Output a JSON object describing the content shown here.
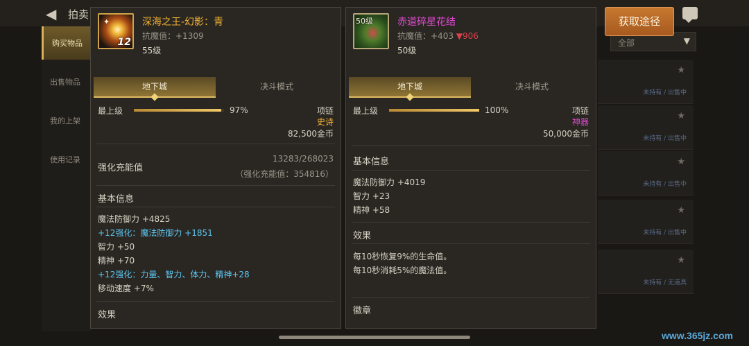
{
  "background": {
    "title": "拍卖",
    "sidebar": [
      "购买物品",
      "出售物品",
      "我的上架",
      "使用记录"
    ],
    "dropdown": "全部",
    "rows": [
      {
        "status": "未持有 / 出售中"
      },
      {
        "status": "未持有 / 出售中"
      },
      {
        "status": "未持有 / 出售中"
      },
      {
        "status": "未持有 / 出售中"
      },
      {
        "status": "未持有 / 无道具"
      }
    ],
    "get_source_button": "获取途径",
    "watermark": "www.365jz.com"
  },
  "card_left": {
    "name": "深海之王-幻影：青",
    "resist": "抗魔值：+1309",
    "level": "55级",
    "icon_reinforce": "12",
    "tabs": [
      "地下城",
      "决斗模式"
    ],
    "max_label": "最上级",
    "progress": 97,
    "progress_text": "97%",
    "slot": "项链",
    "grade": "史诗",
    "price": "82,500金币",
    "amp_label": "强化充能值",
    "amp_value": "13283/268023",
    "amp_sub": "（强化充能值：354816）",
    "basic_title": "基本信息",
    "stats": [
      {
        "text": "魔法防御力 +4825",
        "blue": false
      },
      {
        "text": "+12强化：魔法防御力 +1851",
        "blue": true
      },
      {
        "text": "智力 +50",
        "blue": false
      },
      {
        "text": "精神 +70",
        "blue": false
      },
      {
        "text": "+12强化：力量、智力、体力、精神+28",
        "blue": true
      },
      {
        "text": "移动速度 +7%",
        "blue": false
      }
    ],
    "effect_title": "效果"
  },
  "card_right": {
    "name": "赤道碎星花结",
    "resist_prefix": "抗魔值：+403",
    "resist_diff": "▼906",
    "level": "50级",
    "icon_level_tag": "50级",
    "tabs": [
      "地下城",
      "决斗模式"
    ],
    "max_label": "最上级",
    "progress": 100,
    "progress_text": "100%",
    "slot": "项链",
    "grade": "神器",
    "price": "50,000金币",
    "basic_title": "基本信息",
    "stats": [
      {
        "text": "魔法防御力 +4019"
      },
      {
        "text": "智力 +23"
      },
      {
        "text": "精神 +58"
      }
    ],
    "effect_title": "效果",
    "effects": [
      "每10秒恢复9%的生命值。",
      "每10秒消耗5%的魔法值。"
    ],
    "emblem_title": "徽章"
  },
  "colors": {
    "epic": "#f2b234",
    "artifact": "#e04ad0",
    "reinforce_blue": "#5cc6f0",
    "decrease_red": "#e0404a"
  }
}
